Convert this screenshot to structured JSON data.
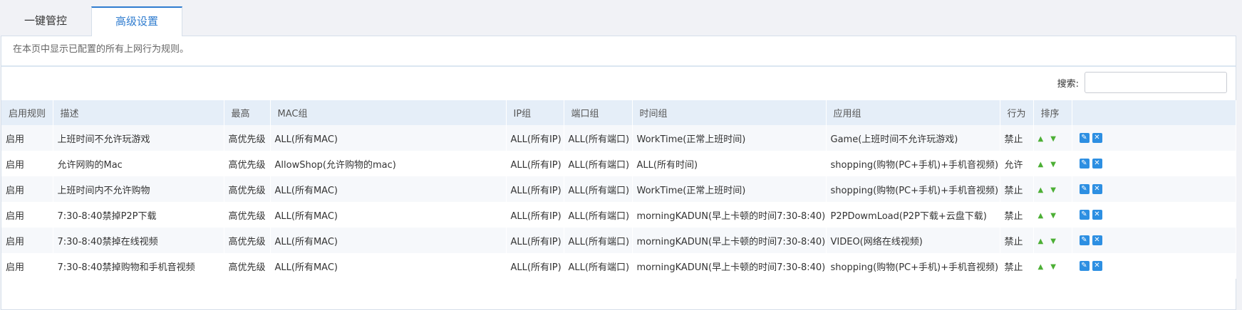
{
  "tabs": [
    "一键管控",
    "高级设置"
  ],
  "description": "在本页中显示已配置的所有上网行为规则。",
  "search": {
    "label": "搜索:",
    "value": ""
  },
  "columns": [
    "启用规则",
    "描述",
    "最高",
    "MAC组",
    "IP组",
    "端口组",
    "时间组",
    "应用组",
    "行为",
    "排序",
    ""
  ],
  "rows": [
    [
      "启用",
      "上班时间不允许玩游戏",
      "高优先级",
      "ALL(所有MAC)",
      "ALL(所有IP)",
      "ALL(所有端口)",
      "WorkTime(正常上班时间)",
      "Game(上班时间不允许玩游戏)",
      "禁止"
    ],
    [
      "启用",
      "允许网购的Mac",
      "高优先级",
      "AllowShop(允许购物的mac)",
      "ALL(所有IP)",
      "ALL(所有端口)",
      "ALL(所有时间)",
      "shopping(购物(PC+手机)+手机音视频)",
      "允许"
    ],
    [
      "启用",
      "上班时间内不允许购物",
      "高优先级",
      "ALL(所有MAC)",
      "ALL(所有IP)",
      "ALL(所有端口)",
      "WorkTime(正常上班时间)",
      "shopping(购物(PC+手机)+手机音视频)",
      "禁止"
    ],
    [
      "启用",
      "7:30-8:40禁掉P2P下载",
      "高优先级",
      "ALL(所有MAC)",
      "ALL(所有IP)",
      "ALL(所有端口)",
      "morningKADUN(早上卡顿的时间7:30-8:40)",
      "P2PDowmLoad(P2P下载+云盘下载)",
      "禁止"
    ],
    [
      "启用",
      "7:30-8:40禁掉在线视频",
      "高优先级",
      "ALL(所有MAC)",
      "ALL(所有IP)",
      "ALL(所有端口)",
      "morningKADUN(早上卡顿的时间7:30-8:40)",
      "VIDEO(网络在线视频)",
      "禁止"
    ],
    [
      "启用",
      "7:30-8:40禁掉购物和手机音视频",
      "高优先级",
      "ALL(所有MAC)",
      "ALL(所有IP)",
      "ALL(所有端口)",
      "morningKADUN(早上卡顿的时间7:30-8:40)",
      "shopping(购物(PC+手机)+手机音视频)",
      "禁止"
    ]
  ],
  "icons": {
    "up": "arrow-up-icon",
    "down": "arrow-down-icon",
    "edit": "edit-icon",
    "delete": "delete-icon"
  },
  "colors": {
    "accent": "#2f7ccf",
    "header_bg": "#e5eef8",
    "arrow": "#4caf35",
    "button": "#2d8fe2"
  }
}
